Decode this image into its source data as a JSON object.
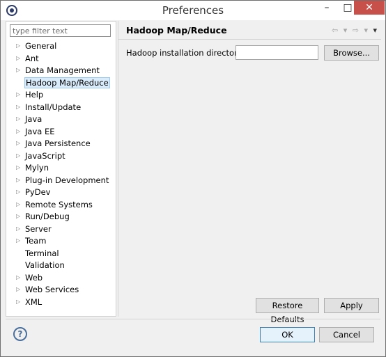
{
  "window": {
    "title": "Preferences",
    "minimize": "–",
    "maximize": "□",
    "close": "✕"
  },
  "filter": {
    "placeholder": "type filter text"
  },
  "tree": [
    {
      "label": "General",
      "expandable": true
    },
    {
      "label": "Ant",
      "expandable": true
    },
    {
      "label": "Data Management",
      "expandable": true
    },
    {
      "label": "Hadoop Map/Reduce",
      "expandable": false,
      "selected": true
    },
    {
      "label": "Help",
      "expandable": true
    },
    {
      "label": "Install/Update",
      "expandable": true
    },
    {
      "label": "Java",
      "expandable": true
    },
    {
      "label": "Java EE",
      "expandable": true
    },
    {
      "label": "Java Persistence",
      "expandable": true
    },
    {
      "label": "JavaScript",
      "expandable": true
    },
    {
      "label": "Mylyn",
      "expandable": true
    },
    {
      "label": "Plug-in Development",
      "expandable": true
    },
    {
      "label": "PyDev",
      "expandable": true
    },
    {
      "label": "Remote Systems",
      "expandable": true
    },
    {
      "label": "Run/Debug",
      "expandable": true
    },
    {
      "label": "Server",
      "expandable": true
    },
    {
      "label": "Team",
      "expandable": true
    },
    {
      "label": "Terminal",
      "expandable": false
    },
    {
      "label": "Validation",
      "expandable": false
    },
    {
      "label": "Web",
      "expandable": true
    },
    {
      "label": "Web Services",
      "expandable": true
    },
    {
      "label": "XML",
      "expandable": true
    }
  ],
  "page": {
    "title": "Hadoop Map/Reduce",
    "nav": {
      "back": "⇦",
      "forward": "⇨",
      "dropdown": "▾",
      "menu": "▾"
    },
    "field_label": "Hadoop installation directory:",
    "field_value": "",
    "browse_label": "Browse...",
    "restore_label": "Restore Defaults",
    "apply_label": "Apply"
  },
  "footer": {
    "help_symbol": "?",
    "ok_label": "OK",
    "cancel_label": "Cancel"
  },
  "colors": {
    "selection_bg": "#d9ecfb",
    "close_btn": "#c7504b",
    "ok_border": "#3c7fb1"
  }
}
